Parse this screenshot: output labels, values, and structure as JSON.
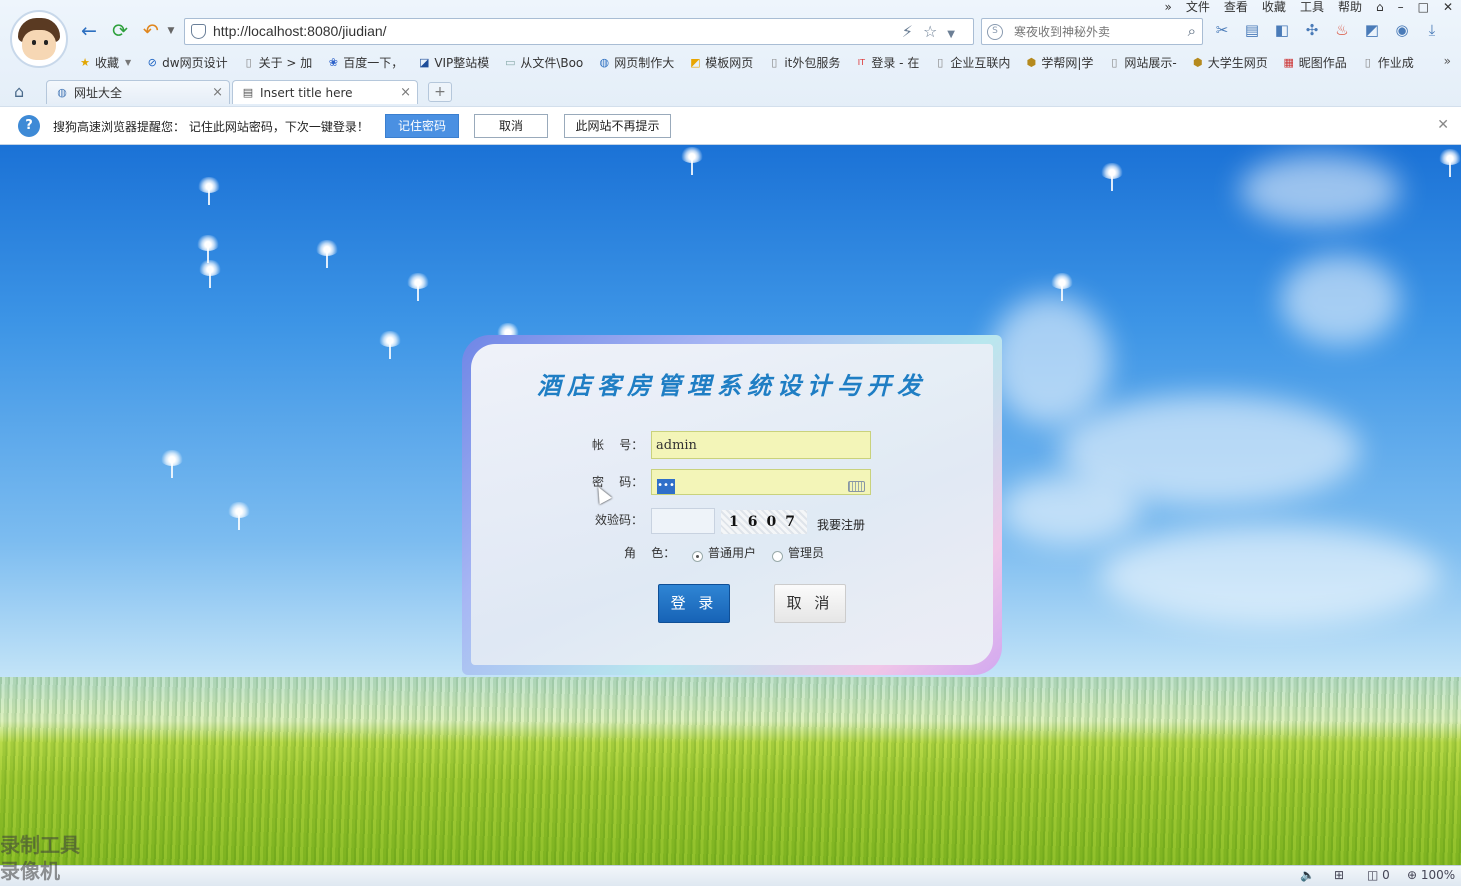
{
  "window_menu": [
    "»",
    "文件",
    "查看",
    "收藏",
    "工具",
    "帮助"
  ],
  "address": {
    "url": "http://localhost:8080/jiudian/"
  },
  "search": {
    "placeholder": "寒夜收到神秘外卖"
  },
  "bookmarks": [
    {
      "label": "收藏",
      "icon": "star-icon"
    },
    {
      "label": "dw网页设计",
      "icon": "link-icon"
    },
    {
      "label": "关于 > 加",
      "icon": "page-icon"
    },
    {
      "label": "百度一下，",
      "icon": "paw-icon"
    },
    {
      "label": "VIP整站模",
      "icon": "vip-icon"
    },
    {
      "label": "从文件\\Boo",
      "icon": "folder-icon"
    },
    {
      "label": "网页制作大",
      "icon": "globe-icon"
    },
    {
      "label": "模板网页",
      "icon": "template-icon"
    },
    {
      "label": "it外包服务",
      "icon": "page-icon"
    },
    {
      "label": "登录 - 在",
      "icon": "login-icon"
    },
    {
      "label": "企业互联内",
      "icon": "page-icon"
    },
    {
      "label": "学帮网|学",
      "icon": "hex-icon"
    },
    {
      "label": "网站展示-",
      "icon": "page-icon"
    },
    {
      "label": "大学生网页",
      "icon": "hex-icon"
    },
    {
      "label": "昵图作品",
      "icon": "nipic-icon"
    },
    {
      "label": "作业成",
      "icon": "page-icon"
    }
  ],
  "tabs": [
    {
      "label": "网址大全",
      "icon": "globe-icon"
    },
    {
      "label": "Insert title here",
      "icon": "page-icon"
    }
  ],
  "notice": {
    "message": "搜狗高速浏览器提醒您： 记住此网站密码，下次一键登录！",
    "remember": "记住密码",
    "cancel": "取消",
    "never": "此网站不再提示"
  },
  "login": {
    "title": "酒店客房管理系统设计与开发",
    "account_label": "帐    号：",
    "account_value": "admin",
    "password_label": "密    码：",
    "password_mask": "•••",
    "captcha_label": "效验码：",
    "captcha_code": "1607",
    "register_link": "我要注册",
    "role_label": "角    色：",
    "role_options": [
      "普通用户",
      "管理员"
    ],
    "role_selected": "普通用户",
    "login_button": "登 录",
    "cancel_button": "取 消"
  },
  "status_bar": {
    "sound": "",
    "counter": "0",
    "zoom": "100%"
  },
  "watermark": [
    "录制工具",
    "录像机"
  ],
  "colors": {
    "accent": "#1f7ec4",
    "button": "#1763b6",
    "field": "#f3f5b8"
  }
}
